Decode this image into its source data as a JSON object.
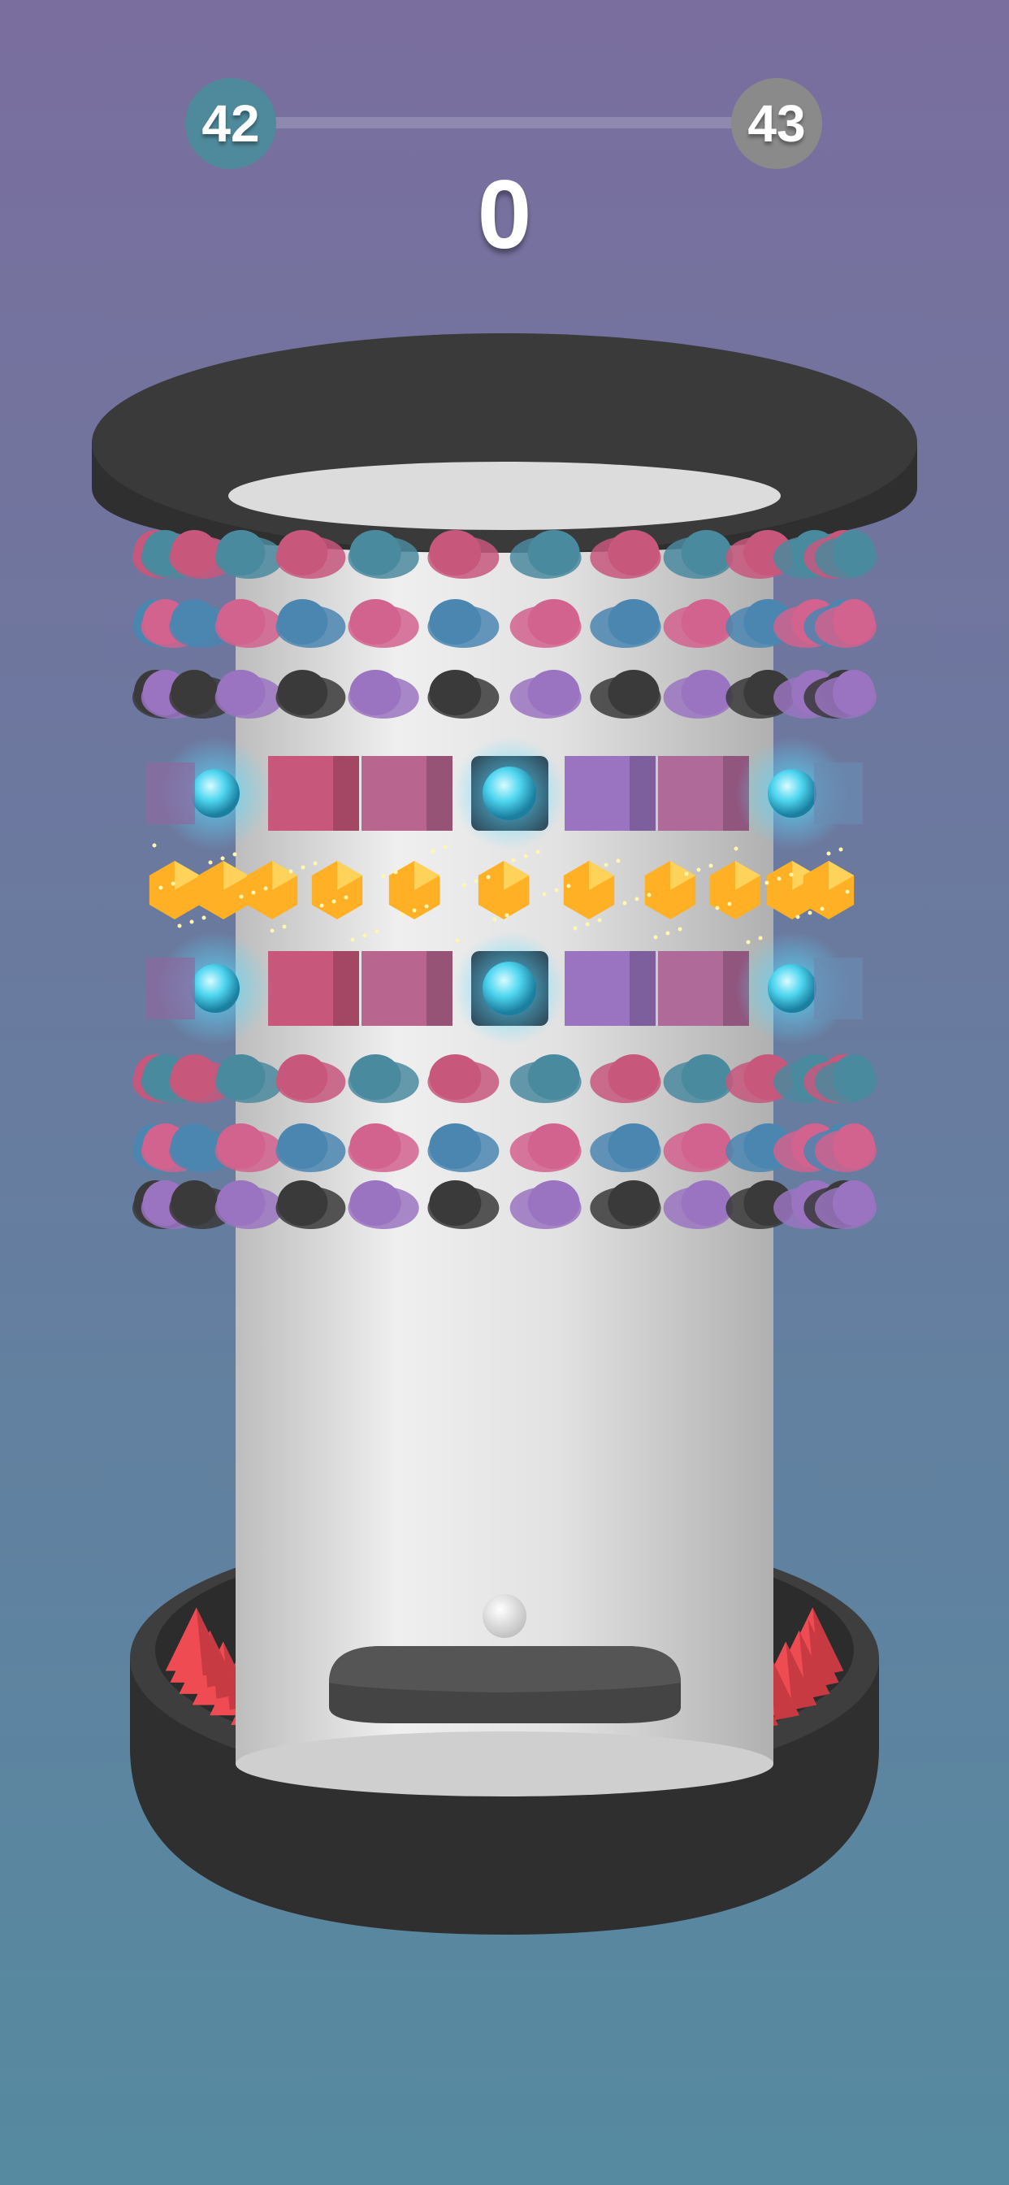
{
  "hud": {
    "current_level": "42",
    "next_level": "43",
    "score": "0",
    "level_progress": 0
  },
  "colors": {
    "bg_top": "#7a6e9e",
    "bg_bottom": "#558aa0",
    "current_level_badge": "#4f8a9c",
    "next_level_badge": "#8a8a8a",
    "tower": "#e4e4e4",
    "tower_rim": "#3a3a3a",
    "spikes": "#ef4b52",
    "ball": "#f2f2f2",
    "gold_gems": "#ffb024",
    "electric_orbs": "#4fd6f0",
    "peg_colors": [
      "#c8577c",
      "#9a74c0",
      "#4a86b0",
      "#4a8a9e",
      "#3a3a3a",
      "#d2628e"
    ]
  }
}
